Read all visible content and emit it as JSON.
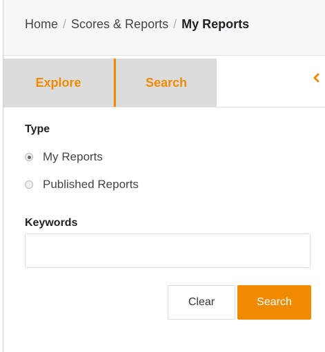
{
  "breadcrumb": {
    "items": [
      "Home",
      "Scores & Reports"
    ],
    "separator": "/",
    "current": "My Reports"
  },
  "tabs": {
    "explore": "Explore",
    "search": "Search",
    "collapse_icon": "chevron-left-icon"
  },
  "form": {
    "type_label": "Type",
    "type_options": [
      "My Reports",
      "Published Reports"
    ],
    "selected_type": "My Reports",
    "keywords_label": "Keywords",
    "keywords_value": "",
    "keywords_placeholder": ""
  },
  "buttons": {
    "clear": "Clear",
    "search": "Search"
  },
  "colors": {
    "accent": "#f08a00",
    "tab_background": "#dcdcdc",
    "breadcrumb_background": "#f6f7f9"
  }
}
